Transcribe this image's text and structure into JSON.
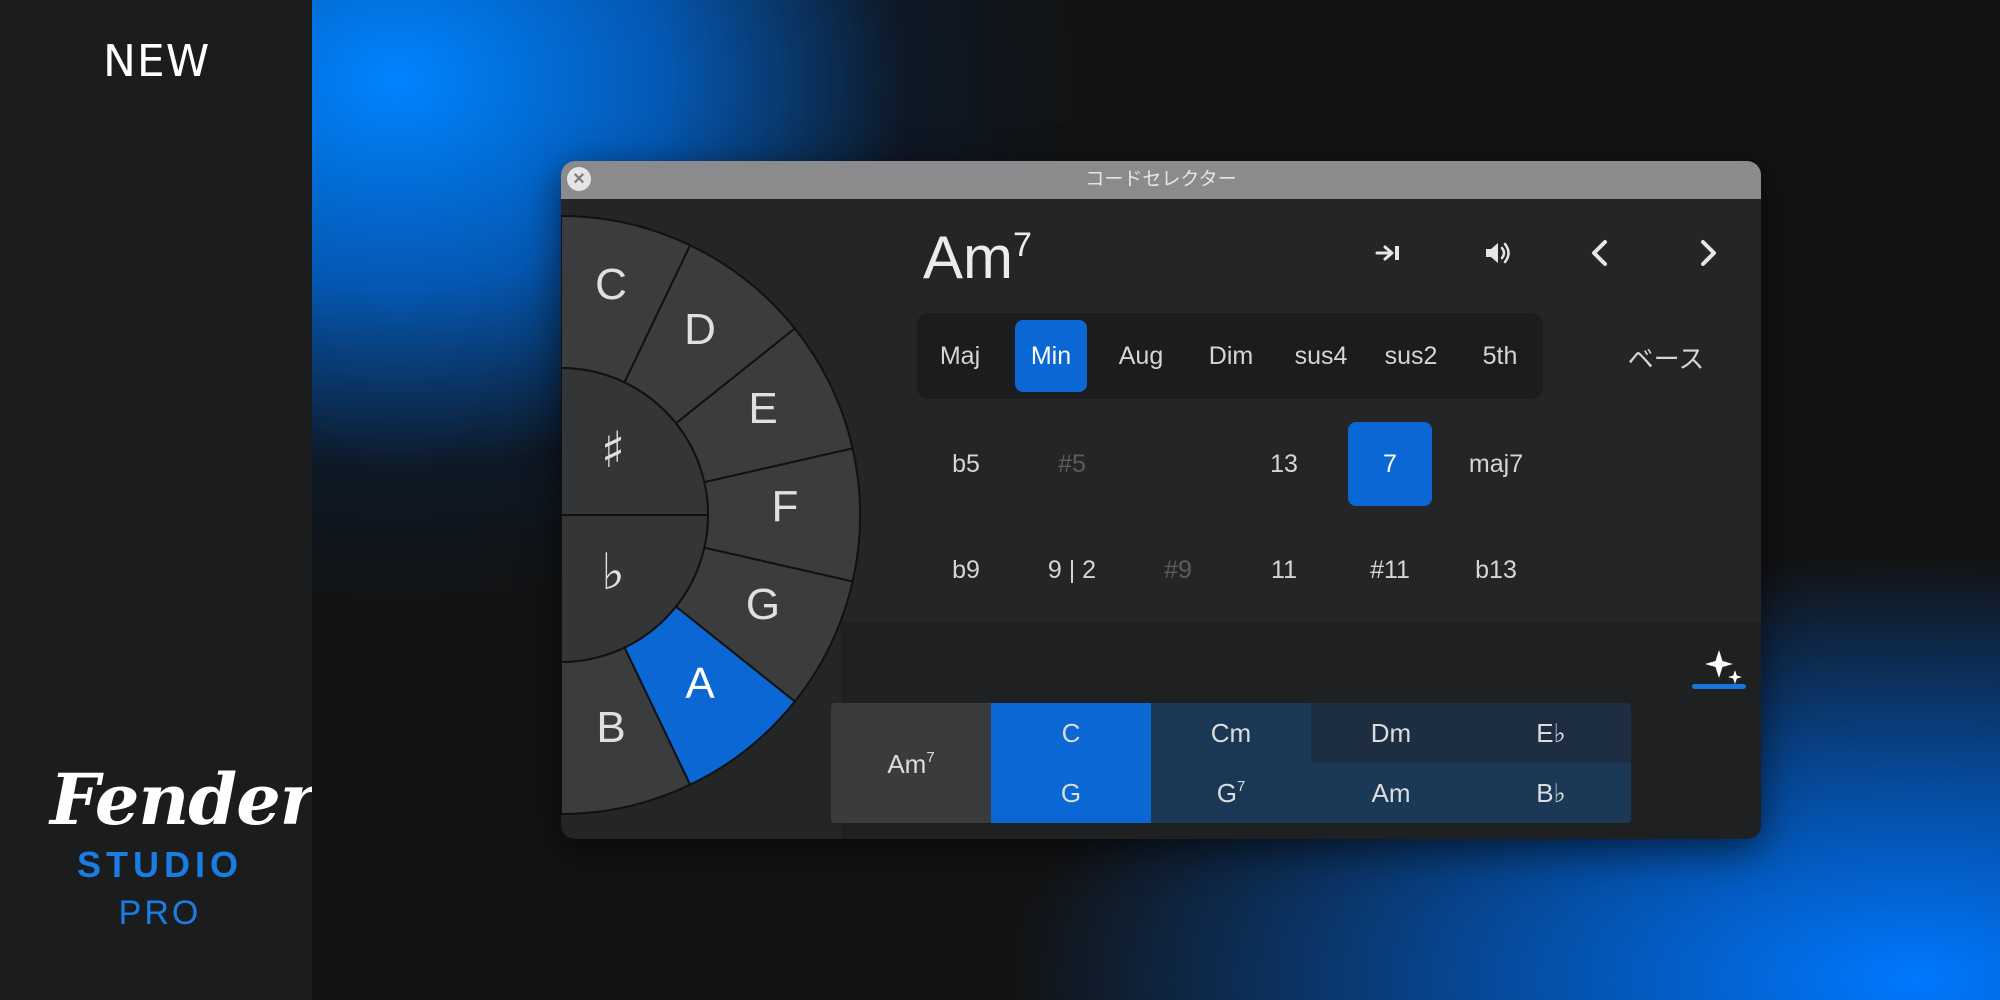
{
  "brand": {
    "new_label": "NEW",
    "logo_script": "Fender",
    "logo_studio": "STUDIO",
    "logo_pro": "PRO",
    "accent_color": "#0a67d4"
  },
  "window": {
    "title": "コードセレクター",
    "close_icon": "close-icon"
  },
  "wheel": {
    "outer_notes": [
      "C",
      "D",
      "E",
      "F",
      "G",
      "A",
      "B"
    ],
    "selected_note": "A",
    "accidentals": [
      "♯",
      "♭"
    ]
  },
  "chord": {
    "root": "Am",
    "extension": "7"
  },
  "toolbar": {
    "icons": [
      "insert-icon",
      "speaker-icon",
      "prev-icon",
      "next-icon"
    ]
  },
  "qualities": {
    "items": [
      "Maj",
      "Min",
      "Aug",
      "Dim",
      "sus4",
      "sus2",
      "5th"
    ],
    "selected": "Min",
    "bass_label": "ベース"
  },
  "extensions": {
    "row1": [
      "b5",
      "#5",
      "13",
      "7",
      "maj7"
    ],
    "row2": [
      "b9",
      "9 | 2",
      "#9",
      "11",
      "#11",
      "b13"
    ],
    "selected": "7",
    "disabled": [
      "#5",
      "#9"
    ]
  },
  "suggestions": {
    "current": {
      "root": "Am",
      "ext": "7"
    },
    "grid": [
      [
        {
          "root": "C",
          "ext": ""
        },
        {
          "root": "Cm",
          "ext": ""
        },
        {
          "root": "Dm",
          "ext": ""
        },
        {
          "root": "E♭",
          "ext": ""
        }
      ],
      [
        {
          "root": "G",
          "ext": ""
        },
        {
          "root": "G",
          "ext": "7"
        },
        {
          "root": "Am",
          "ext": ""
        },
        {
          "root": "B♭",
          "ext": ""
        }
      ]
    ]
  }
}
